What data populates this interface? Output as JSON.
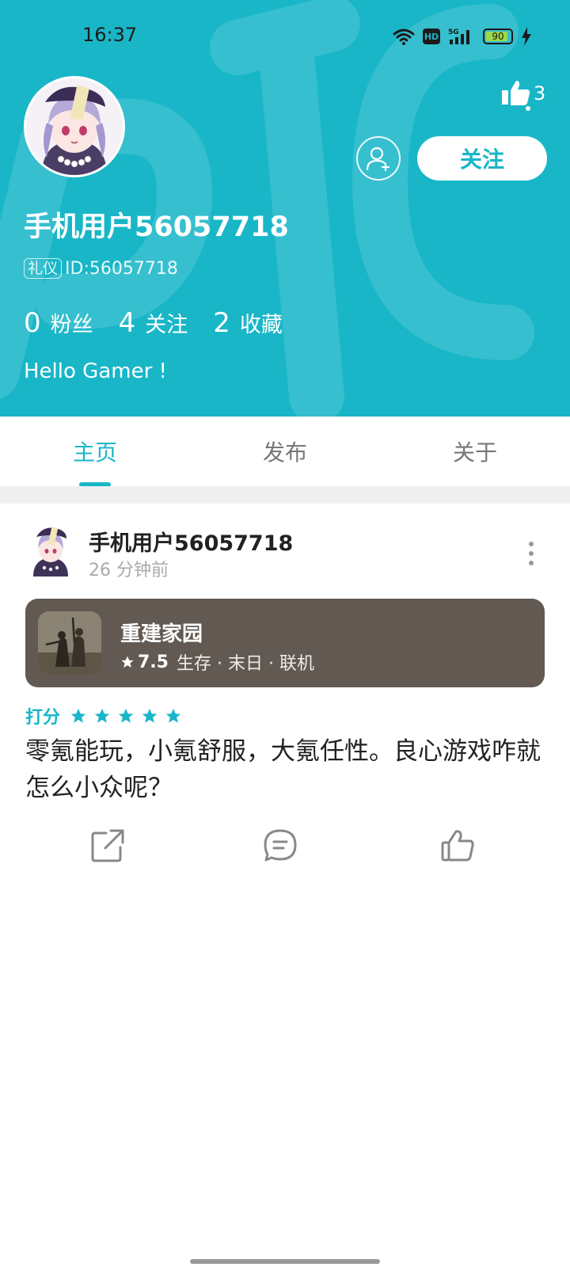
{
  "status_bar": {
    "time": "16:37",
    "hd_label": "HD",
    "network_label": "5G",
    "battery_level": 90,
    "battery_label": "90",
    "icons": [
      "wifi-icon",
      "hd-icon",
      "signal-5g-icon",
      "battery-icon",
      "charging-icon"
    ]
  },
  "profile": {
    "username": "手机用户56057718",
    "id_badge": "礼仪",
    "id_text": "ID:56057718",
    "likes_count": "3",
    "follow_label": "关注",
    "stats": [
      {
        "value": "0",
        "label": "粉丝"
      },
      {
        "value": "4",
        "label": "关注"
      },
      {
        "value": "2",
        "label": "收藏"
      }
    ],
    "bio": "Hello Gamer !"
  },
  "tabs": [
    {
      "label": "主页",
      "active": true
    },
    {
      "label": "发布",
      "active": false
    },
    {
      "label": "关于",
      "active": false
    }
  ],
  "post": {
    "author": "手机用户56057718",
    "time": "26 分钟前",
    "game": {
      "title": "重建家园",
      "rating": "7.5",
      "tags": "生存 · 末日 · 联机"
    },
    "rating_label": "打分",
    "stars": 5,
    "text": "零氪能玩，小氪舒服，大氪任性。良心游戏咋就怎么小众呢？"
  },
  "colors": {
    "accent": "#19b6c8",
    "game_card": "#625a52",
    "divider": "#efefef"
  }
}
